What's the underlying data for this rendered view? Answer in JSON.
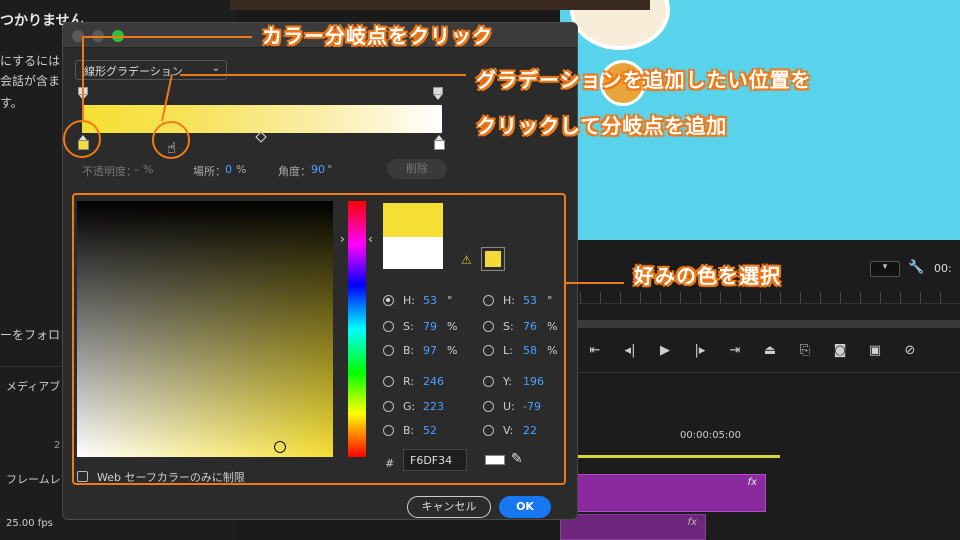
{
  "background": {
    "left": {
      "message_title": "つかりません",
      "message_lines": [
        "にするには",
        "会話が含ま",
        "す。"
      ],
      "follow_label": "ーをフォロ",
      "media_label": "メディアブ",
      "count": "2",
      "frame_label": "フレームレ",
      "fps": "25.00 fps"
    },
    "right": {
      "timecode_top": "00:",
      "timeline_time": "00:00:05:00",
      "fx_label": "fx"
    }
  },
  "dialog": {
    "gradient_type": "線形グラデーション",
    "gradient_colors": [
      "#f6df34",
      "#ffffff"
    ],
    "opacity_label": "不透明度：",
    "opacity_value": "– %",
    "location_label": "場所：",
    "location_value": "0",
    "location_unit": "%",
    "angle_label": "角度：",
    "angle_value": "90",
    "angle_unit": "°",
    "delete_label": "削除",
    "new_color": "#f6df34",
    "old_color": "#ffffff",
    "fields_left": [
      {
        "key": "H:",
        "value": "53",
        "unit": "°",
        "selected": true
      },
      {
        "key": "S:",
        "value": "79",
        "unit": "%",
        "selected": false
      },
      {
        "key": "B:",
        "value": "97",
        "unit": "%",
        "selected": false
      },
      {
        "key": "R:",
        "value": "246",
        "unit": "",
        "selected": false
      },
      {
        "key": "G:",
        "value": "223",
        "unit": "",
        "selected": false
      },
      {
        "key": "B:",
        "value": "52",
        "unit": "",
        "selected": false
      }
    ],
    "fields_right": [
      {
        "key": "H:",
        "value": "53",
        "unit": "°",
        "selected": false
      },
      {
        "key": "S:",
        "value": "76",
        "unit": "%",
        "selected": false
      },
      {
        "key": "L:",
        "value": "58",
        "unit": "%",
        "selected": false
      },
      {
        "key": "Y:",
        "value": "196",
        "unit": "",
        "selected": false
      },
      {
        "key": "U:",
        "value": "-79",
        "unit": "",
        "selected": false
      },
      {
        "key": "V:",
        "value": "22",
        "unit": "",
        "selected": false
      }
    ],
    "hex_label": "#",
    "hex_value": "F6DF34",
    "websafe_label": "Web セーフカラーのみに制限",
    "cancel_label": "キャンセル",
    "ok_label": "OK"
  },
  "annotations": {
    "click_stop": "カラー分岐点をクリック",
    "add_stop_line1": "グラデーションを追加したい位置を",
    "add_stop_line2": "クリックして分岐点を追加",
    "choose_color": "好みの色を選択"
  },
  "colors": {
    "accent_annotation": "#f07a18",
    "ok_button": "#1677f0",
    "value_text": "#4aa3ff"
  }
}
